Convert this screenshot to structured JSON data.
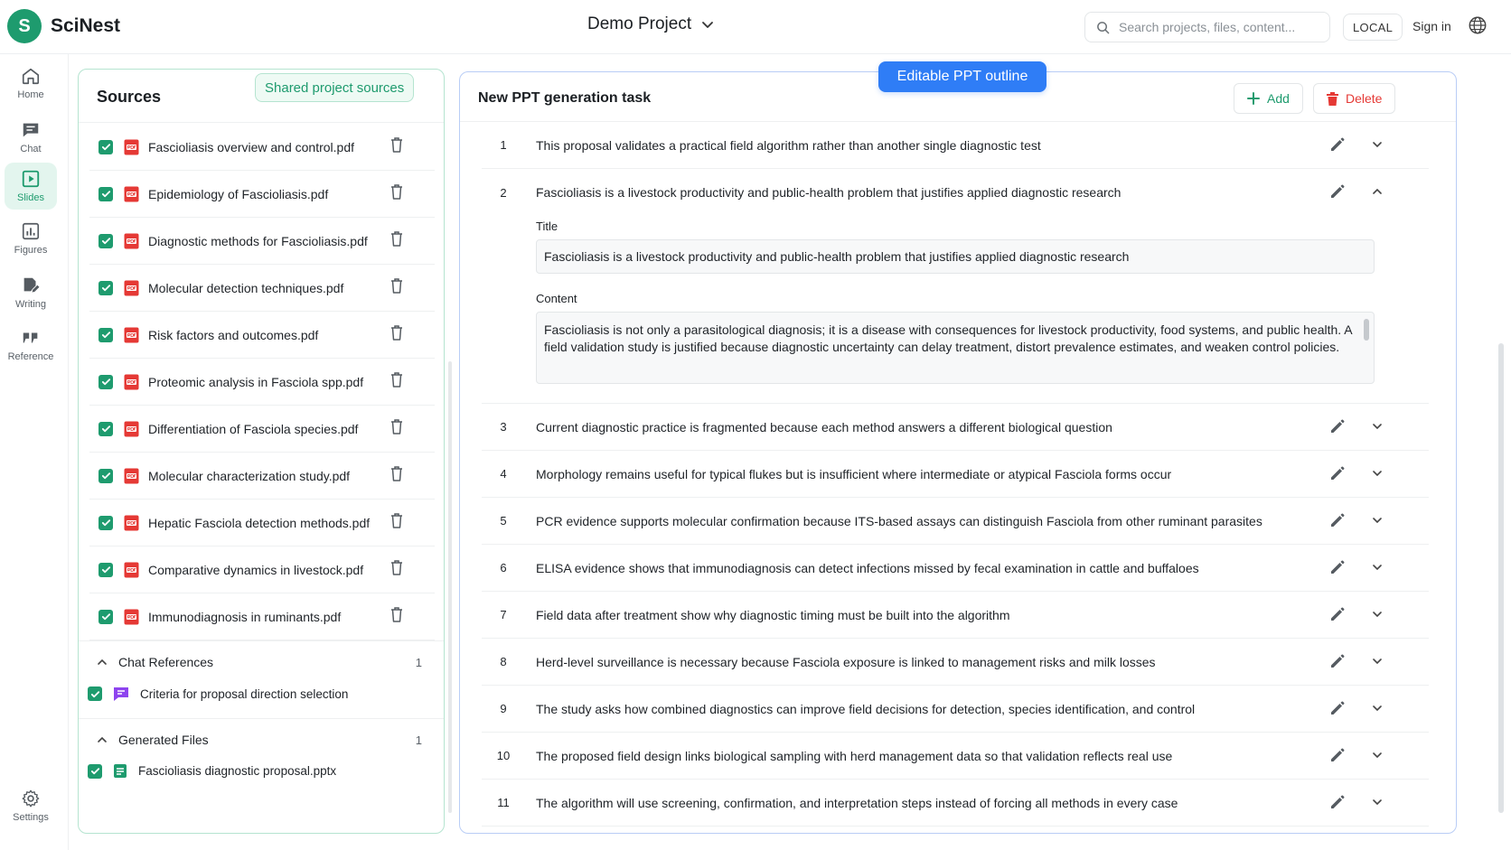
{
  "app": {
    "logo_letter": "S",
    "name": "SciNest"
  },
  "header": {
    "project_name": "Demo Project",
    "search_placeholder": "Search projects, files, content...",
    "mode_badge": "LOCAL",
    "sign_in": "Sign in"
  },
  "nav": {
    "items": [
      {
        "label": "Home",
        "icon": "home-icon"
      },
      {
        "label": "Chat",
        "icon": "chat-icon"
      },
      {
        "label": "Slides",
        "icon": "slides-icon",
        "active": true
      },
      {
        "label": "Figures",
        "icon": "figures-icon"
      },
      {
        "label": "Writing",
        "icon": "writing-icon"
      },
      {
        "label": "Reference",
        "icon": "quote-icon"
      }
    ],
    "settings_label": "Settings"
  },
  "sources": {
    "title": "Sources",
    "shared_badge": "Shared project sources",
    "files": [
      "Fascioliasis overview and control.pdf",
      "Epidemiology of Fascioliasis.pdf",
      "Diagnostic methods for Fascioliasis.pdf",
      "Molecular detection techniques.pdf",
      "Risk factors and outcomes.pdf",
      "Proteomic analysis in Fasciola spp.pdf",
      "Differentiation of Fasciola species.pdf",
      "Molecular characterization study.pdf",
      "Hepatic Fasciola detection methods.pdf",
      "Comparative dynamics in livestock.pdf",
      "Immunodiagnosis in ruminants.pdf"
    ],
    "chat_references": {
      "label": "Chat References",
      "count": "1",
      "items": [
        "Criteria for proposal direction selection"
      ]
    },
    "generated_files": {
      "label": "Generated Files",
      "count": "1",
      "items": [
        "Fascioliasis diagnostic proposal.pptx"
      ]
    }
  },
  "outline": {
    "tag": "Editable PPT outline",
    "title": "New PPT generation task",
    "add_label": "Add",
    "delete_label": "Delete",
    "title_label": "Title",
    "content_label": "Content",
    "expanded_title_value": "Fascioliasis is a livestock productivity and public-health problem that justifies applied diagnostic research",
    "expanded_content_value": "Fascioliasis is not only a parasitological diagnosis; it is a disease with consequences for livestock productivity, food systems, and public health. A field validation study is justified because diagnostic uncertainty can delay treatment, distort prevalence estimates, and weaken control policies.",
    "items": [
      {
        "num": "1",
        "text": "This proposal validates a practical field algorithm rather than another single diagnostic test"
      },
      {
        "num": "2",
        "text": "Fascioliasis is a livestock productivity and public-health problem that justifies applied diagnostic research",
        "expanded": true
      },
      {
        "num": "3",
        "text": "Current diagnostic practice is fragmented because each method answers a different biological question"
      },
      {
        "num": "4",
        "text": "Morphology remains useful for typical flukes but is insufficient where intermediate or atypical Fasciola forms occur"
      },
      {
        "num": "5",
        "text": "PCR evidence supports molecular confirmation because ITS-based assays can distinguish Fasciola from other ruminant parasites"
      },
      {
        "num": "6",
        "text": "ELISA evidence shows that immunodiagnosis can detect infections missed by fecal examination in cattle and buffaloes"
      },
      {
        "num": "7",
        "text": "Field data after treatment show why diagnostic timing must be built into the algorithm"
      },
      {
        "num": "8",
        "text": "Herd-level surveillance is necessary because Fasciola exposure is linked to management risks and milk losses"
      },
      {
        "num": "9",
        "text": "The study asks how combined diagnostics can improve field decisions for detection, species identification, and control"
      },
      {
        "num": "10",
        "text": "The proposed field design links biological sampling with herd management data so that validation reflects real use"
      },
      {
        "num": "11",
        "text": "The algorithm will use screening, confirmation, and interpretation steps instead of forcing all methods in every case"
      }
    ]
  },
  "colors": {
    "brand": "#1e9b6e",
    "accent_blue": "#2f7df6",
    "danger": "#e53935",
    "pdf_red": "#e53935"
  }
}
